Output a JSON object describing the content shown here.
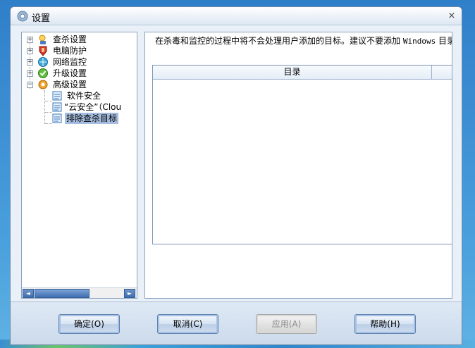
{
  "window": {
    "title": "设置",
    "close_symbol": "×"
  },
  "tree": {
    "items": [
      {
        "label": "查杀设置",
        "icon": "magnifier-shield-icon",
        "expander": "+"
      },
      {
        "label": "电脑防护",
        "icon": "hand-shield-icon",
        "expander": "+"
      },
      {
        "label": "网络监控",
        "icon": "network-globe-icon",
        "expander": "+"
      },
      {
        "label": "升级设置",
        "icon": "green-check-globe-icon",
        "expander": "+"
      },
      {
        "label": "高级设置",
        "icon": "gear-icon",
        "expander": "−"
      }
    ],
    "children": [
      {
        "label": "软件安全",
        "icon": "page-icon"
      },
      {
        "label": "“云安全”（Clou",
        "icon": "page-icon"
      },
      {
        "label": "排除查杀目标",
        "icon": "page-icon",
        "selected": true
      }
    ],
    "scroll_left": "◄",
    "scroll_right": "►"
  },
  "main": {
    "description_cn": "在杀毒和监控的过程中将不会处理用户添加的目标。建议不要添加 ",
    "description_mono": "Windows",
    "description_tail": " 目录",
    "list_header": "目录"
  },
  "buttons": {
    "ok": "确定(O)",
    "cancel": "取消(C)",
    "apply": "应用(A)",
    "help": "帮助(H)"
  }
}
